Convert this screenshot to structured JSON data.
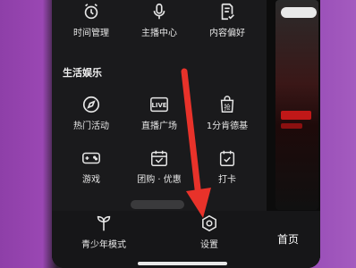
{
  "top_row": [
    {
      "label": "时间管理",
      "icon": "alarm-clock-icon"
    },
    {
      "label": "主播中心",
      "icon": "microphone-icon"
    },
    {
      "label": "内容偏好",
      "icon": "document-check-icon"
    }
  ],
  "section": {
    "title": "生活娱乐"
  },
  "row_two": [
    {
      "label": "热门活动",
      "icon": "compass-icon"
    },
    {
      "label": "直播广场",
      "icon": "live-badge-icon",
      "badge": "LIVE"
    },
    {
      "label": "1分肯德基",
      "icon": "grab-bag-icon",
      "badge": "抢"
    }
  ],
  "row_three": [
    {
      "label": "游戏",
      "icon": "gamepad-icon"
    },
    {
      "label": "团购 · 优惠",
      "icon": "coupon-calendar-icon"
    },
    {
      "label": "打卡",
      "icon": "calendar-check-icon"
    }
  ],
  "bottom": [
    {
      "label": "青少年模式",
      "icon": "sprout-icon"
    },
    {
      "label": "设置",
      "icon": "gear-hexagon-icon"
    }
  ],
  "tab_bar": {
    "home": "首页"
  },
  "annotation": {
    "arrow_color": "#e8322a"
  }
}
